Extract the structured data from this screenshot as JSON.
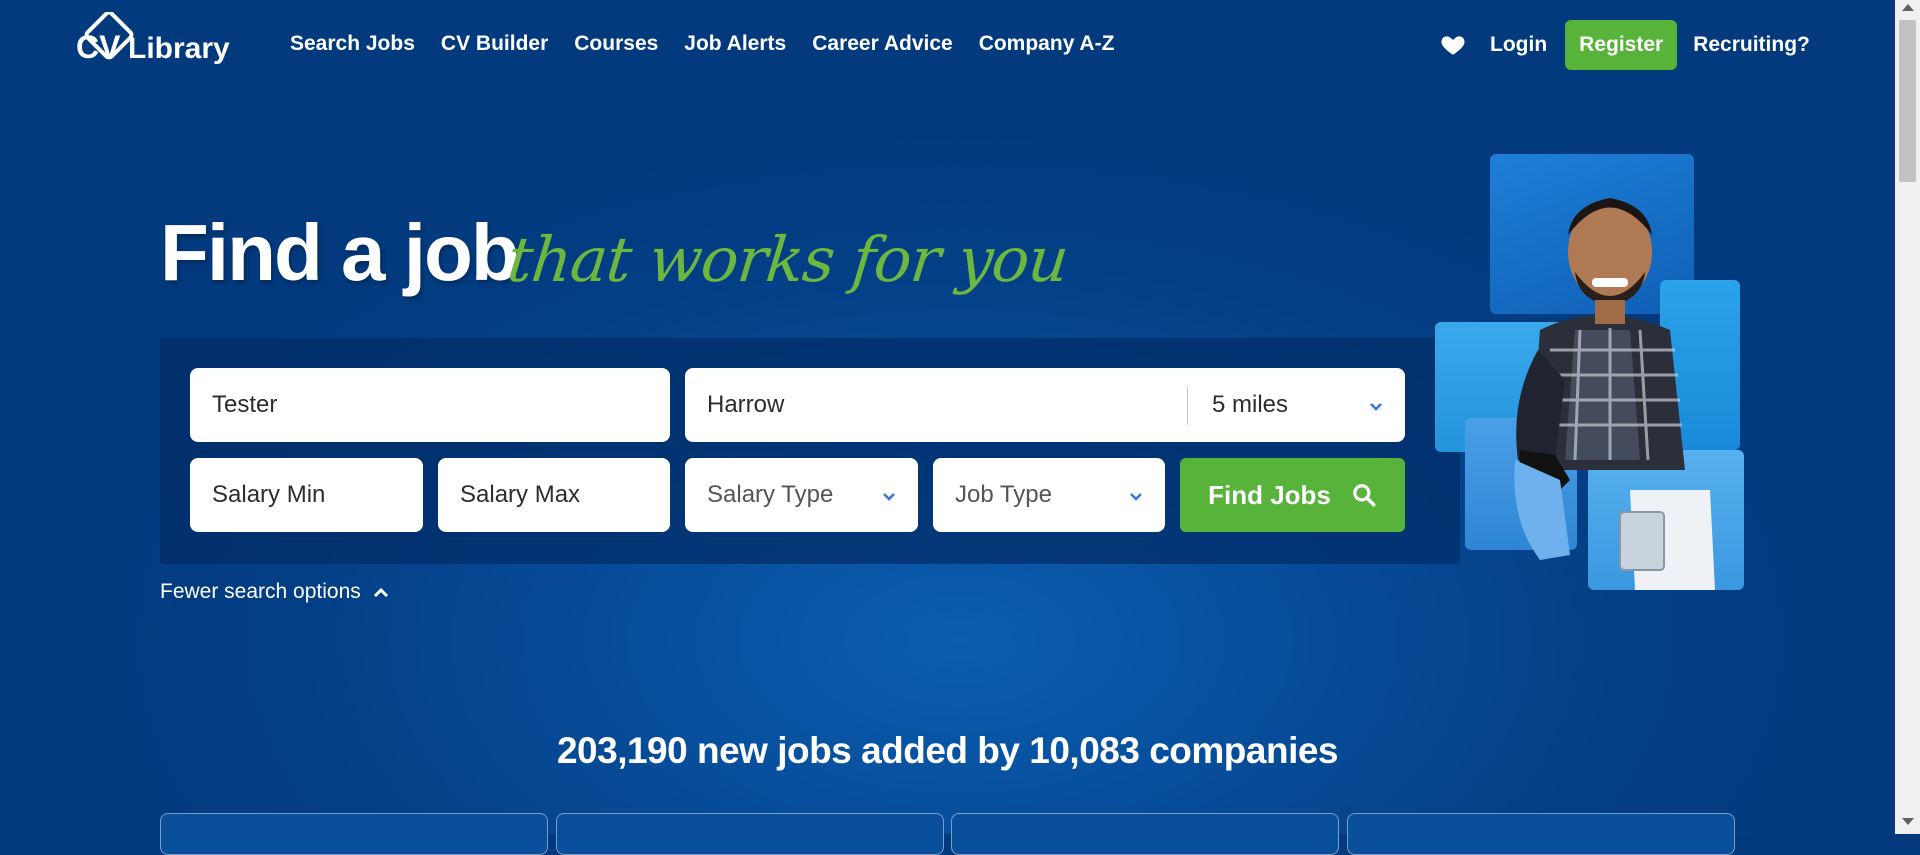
{
  "brand": {
    "logo_text": "CV Library",
    "accent_green": "#58b33b",
    "bg_blue": "#043e85"
  },
  "header": {
    "nav": [
      "Search Jobs",
      "CV Builder",
      "Courses",
      "Job Alerts",
      "Career Advice",
      "Company A-Z"
    ],
    "login_label": "Login",
    "register_label": "Register",
    "recruiting_label": "Recruiting?",
    "favourites_icon": "heart-icon"
  },
  "hero": {
    "title": "Find a job",
    "subtitle": "that works for you"
  },
  "search": {
    "keywords_value": "Tester",
    "location_value": "Harrow",
    "distance_value": "5 miles",
    "salary_min_placeholder": "Salary Min",
    "salary_max_placeholder": "Salary Max",
    "salary_type_label": "Salary Type",
    "job_type_label": "Job Type",
    "find_label": "Find Jobs",
    "find_icon": "search-icon",
    "fewer_options_label": "Fewer search options"
  },
  "stats": {
    "text": "203,190 new jobs added by 10,083 companies"
  }
}
